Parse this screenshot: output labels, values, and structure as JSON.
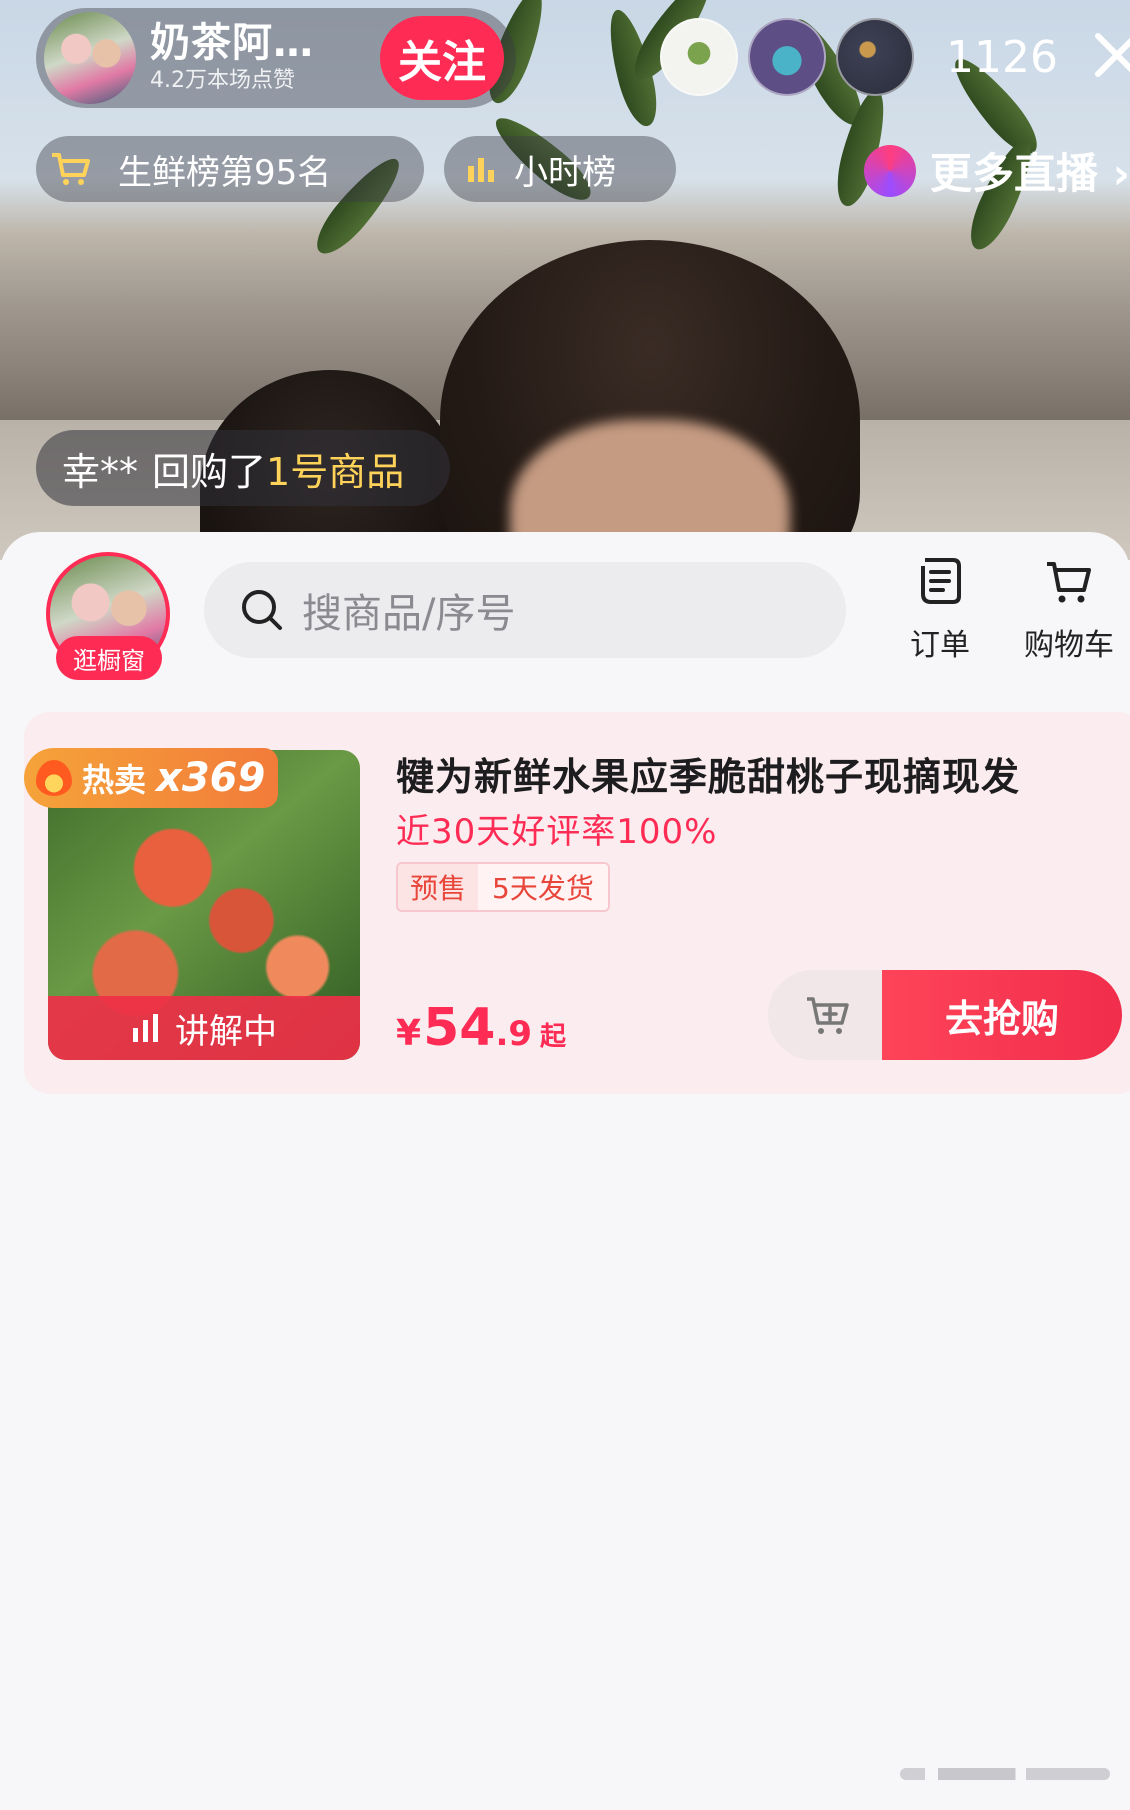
{
  "live": {
    "host_name": "奶茶阿…",
    "host_likes": "4.2万本场点赞",
    "follow_label": "关注",
    "viewer_count": "1126"
  },
  "rank_bar": {
    "fresh_rank": "生鲜榜第95名",
    "hour_rank": "小时榜",
    "more_live": "更多直播 ›"
  },
  "toast": {
    "user": "幸**",
    "action": "回购了",
    "item": "1号商品"
  },
  "sheet": {
    "shop_tag": "逛橱窗",
    "search_placeholder": "搜商品/序号",
    "orders_label": "订单",
    "cart_label": "购物车"
  },
  "product": {
    "hot_label": "热卖",
    "hot_count": "x369",
    "explaining_label": "讲解中",
    "title": "犍为新鲜水果应季脆甜桃子现摘现发",
    "rating": "近30天好评率100%",
    "presale_tag": "预售",
    "ship_tag": "5天发货",
    "price_currency": "¥",
    "price_int": "54",
    "price_dec": ".9",
    "price_suffix": "起",
    "buy_label": "去抢购"
  },
  "colors": {
    "accent": "#fe2c55",
    "rank_gold": "#ffd35a",
    "presale_text": "#e8463a"
  }
}
